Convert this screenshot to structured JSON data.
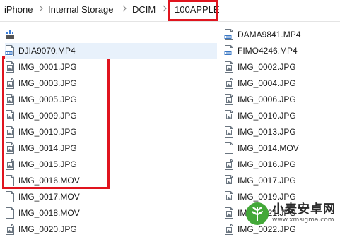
{
  "breadcrumb": {
    "items": [
      "iPhone",
      "Internal Storage",
      "DCIM",
      "100APPLE"
    ]
  },
  "files": {
    "left": [
      {
        "name": "",
        "icon": "device-icon"
      },
      {
        "name": "DJIA9070.MP4",
        "icon": "video-file-icon"
      },
      {
        "name": "IMG_0001.JPG",
        "icon": "image-file-icon"
      },
      {
        "name": "IMG_0003.JPG",
        "icon": "image-file-icon"
      },
      {
        "name": "IMG_0005.JPG",
        "icon": "image-file-icon"
      },
      {
        "name": "IMG_0009.JPG",
        "icon": "image-file-icon"
      },
      {
        "name": "IMG_0010.JPG",
        "icon": "image-file-icon"
      },
      {
        "name": "IMG_0014.JPG",
        "icon": "image-file-icon"
      },
      {
        "name": "IMG_0015.JPG",
        "icon": "image-file-icon"
      },
      {
        "name": "IMG_0016.MOV",
        "icon": "blank-file-icon"
      },
      {
        "name": "IMG_0017.MOV",
        "icon": "blank-file-icon"
      },
      {
        "name": "IMG_0018.MOV",
        "icon": "blank-file-icon"
      },
      {
        "name": "IMG_0020.JPG",
        "icon": "image-file-icon"
      }
    ],
    "right": [
      {
        "name": "DAMA9841.MP4",
        "icon": "video-file-icon"
      },
      {
        "name": "FIMO4246.MP4",
        "icon": "video-file-icon"
      },
      {
        "name": "IMG_0002.JPG",
        "icon": "image-file-icon"
      },
      {
        "name": "IMG_0004.JPG",
        "icon": "image-file-icon"
      },
      {
        "name": "IMG_0006.JPG",
        "icon": "image-file-icon"
      },
      {
        "name": "IMG_0010.JPG",
        "icon": "image-file-icon"
      },
      {
        "name": "IMG_0013.JPG",
        "icon": "image-file-icon"
      },
      {
        "name": "IMG_0014.MOV",
        "icon": "blank-file-icon"
      },
      {
        "name": "IMG_0016.JPG",
        "icon": "image-file-icon"
      },
      {
        "name": "IMG_0017.JPG",
        "icon": "image-file-icon"
      },
      {
        "name": "IMG_0019.JPG",
        "icon": "image-file-icon"
      },
      {
        "name": "IMG_0021.JPG",
        "icon": "image-file-icon"
      },
      {
        "name": "IMG_0022.JPG",
        "icon": "image-file-icon"
      }
    ]
  },
  "watermark": {
    "cn": "小麦安卓网",
    "url": "www.xmsigma.com"
  },
  "colors": {
    "highlight": "#e0141e",
    "selection": "#e8f1fb"
  }
}
